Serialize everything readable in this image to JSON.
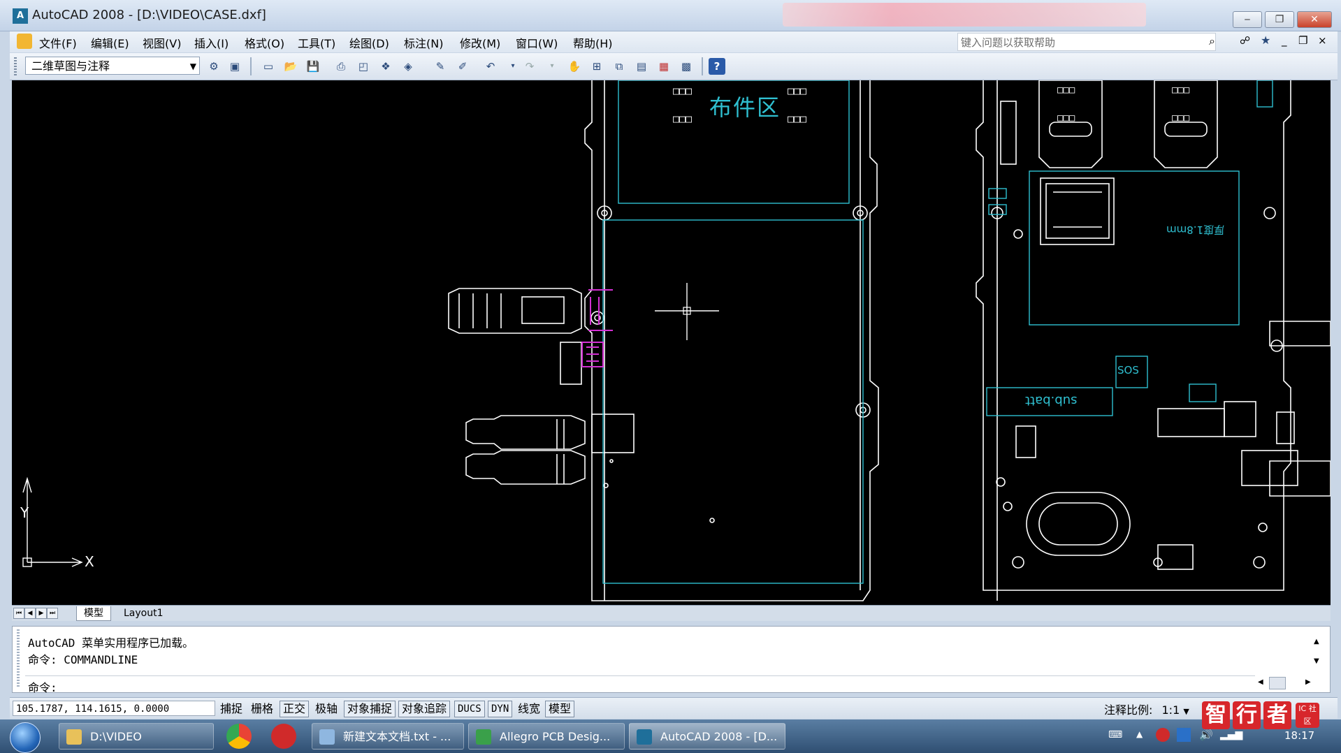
{
  "window": {
    "title": "AutoCAD 2008 - [D:\\VIDEO\\CASE.dxf]",
    "app_icon_text": "A",
    "controls": [
      "‒",
      "❐",
      "✕"
    ]
  },
  "menubar": {
    "items": [
      "文件(F)",
      "编辑(E)",
      "视图(V)",
      "插入(I)",
      "格式(O)",
      "工具(T)",
      "绘图(D)",
      "标注(N)",
      "修改(M)",
      "窗口(W)",
      "帮助(H)"
    ],
    "help_placeholder": "键入问题以获取帮助",
    "doc_controls": [
      "_",
      "❐",
      "×"
    ]
  },
  "toolbar": {
    "workspace": "二维草图与注释",
    "icons": [
      "workspace-settings-icon",
      "workspace-icon",
      "new-icon",
      "open-icon",
      "save-icon",
      "plot-icon",
      "plot-preview-icon",
      "publish-icon",
      "3d-dwf-icon",
      "match-properties-icon",
      "block-editor-icon",
      "undo-icon",
      "redo-icon",
      "pan-icon",
      "zoom-realtime-icon",
      "zoom-window-icon",
      "zoom-previous-icon",
      "properties-icon",
      "design-center-icon",
      "tool-palettes-icon",
      "sheet-set-icon",
      "markup-icon",
      "quickcalc-icon",
      "help-icon"
    ]
  },
  "canvas": {
    "label_area": "布件区",
    "label_sub_batt": "sub.batt",
    "label_sos": "SOS",
    "label_dim": "厚度1.8mm",
    "ucs_x": "X",
    "ucs_y": "Y",
    "placeholder_box": "□□□"
  },
  "tabs": {
    "model": "模型",
    "layout1": "Layout1"
  },
  "command": {
    "line1": "AutoCAD 菜单实用程序已加载。",
    "line2": "命令: COMMANDLINE",
    "prompt": "命令:"
  },
  "status": {
    "coords": "105.1787, 114.1615, 0.0000",
    "toggles": [
      {
        "label": "捕捉",
        "on": false
      },
      {
        "label": "栅格",
        "on": false
      },
      {
        "label": "正交",
        "on": true
      },
      {
        "label": "极轴",
        "on": false
      },
      {
        "label": "对象捕捉",
        "on": true
      },
      {
        "label": "对象追踪",
        "on": true
      },
      {
        "label": "DUCS",
        "on": true
      },
      {
        "label": "DYN",
        "on": true
      },
      {
        "label": "线宽",
        "on": false
      },
      {
        "label": "模型",
        "on": true
      }
    ],
    "annotation_scale_label": "注释比例:",
    "annotation_scale_value": "1:1"
  },
  "taskbar": {
    "tasks": [
      {
        "label": "D:\\VIDEO",
        "color": "#e8c15a"
      },
      {
        "label": "新建文本文档.txt - ...",
        "color": "#8fb7e0"
      },
      {
        "label": "Allegro PCB Desig...",
        "color": "#3aa04a"
      },
      {
        "label": "AutoCAD 2008 - [D...",
        "color": "#1f6f9a"
      }
    ],
    "clock": "18:17"
  },
  "watermark": {
    "chars": [
      "智",
      "行",
      "者"
    ],
    "badge": "IC 社区"
  }
}
